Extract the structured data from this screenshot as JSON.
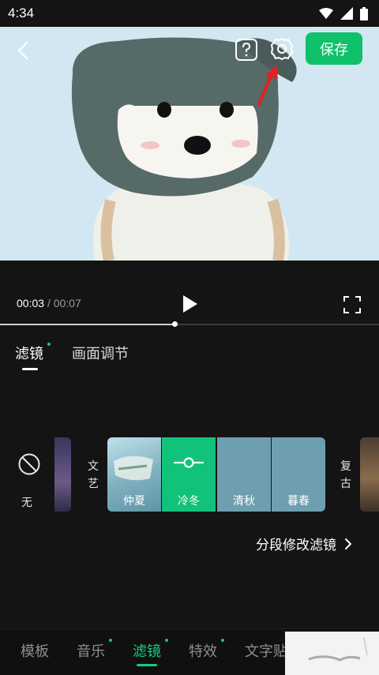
{
  "status": {
    "time": "4:34"
  },
  "header": {
    "save_label": "保存"
  },
  "player": {
    "current_time": "00:03",
    "separator": "/",
    "total_time": "00:07",
    "progress": 0.46
  },
  "subtabs": [
    {
      "label": "滤镜"
    },
    {
      "label": "画面调节"
    }
  ],
  "filters": {
    "none_label": "无",
    "groups": [
      {
        "label": "文艺"
      },
      {
        "label": "复古"
      }
    ],
    "items": [
      {
        "label": "仲夏"
      },
      {
        "label": "冷冬"
      },
      {
        "label": "清秋"
      },
      {
        "label": "暮春"
      }
    ],
    "selected": "冷冬",
    "segment_edit_label": "分段修改滤镜"
  },
  "bottom_tabs": [
    {
      "label": "模板"
    },
    {
      "label": "音乐"
    },
    {
      "label": "滤镜"
    },
    {
      "label": "特效"
    },
    {
      "label": "文字贴"
    }
  ],
  "colors": {
    "accent": "#0fc16a",
    "background": "#141414",
    "preview_bg": "#d3e7f2",
    "tile_bg": "#6e9fb0"
  }
}
